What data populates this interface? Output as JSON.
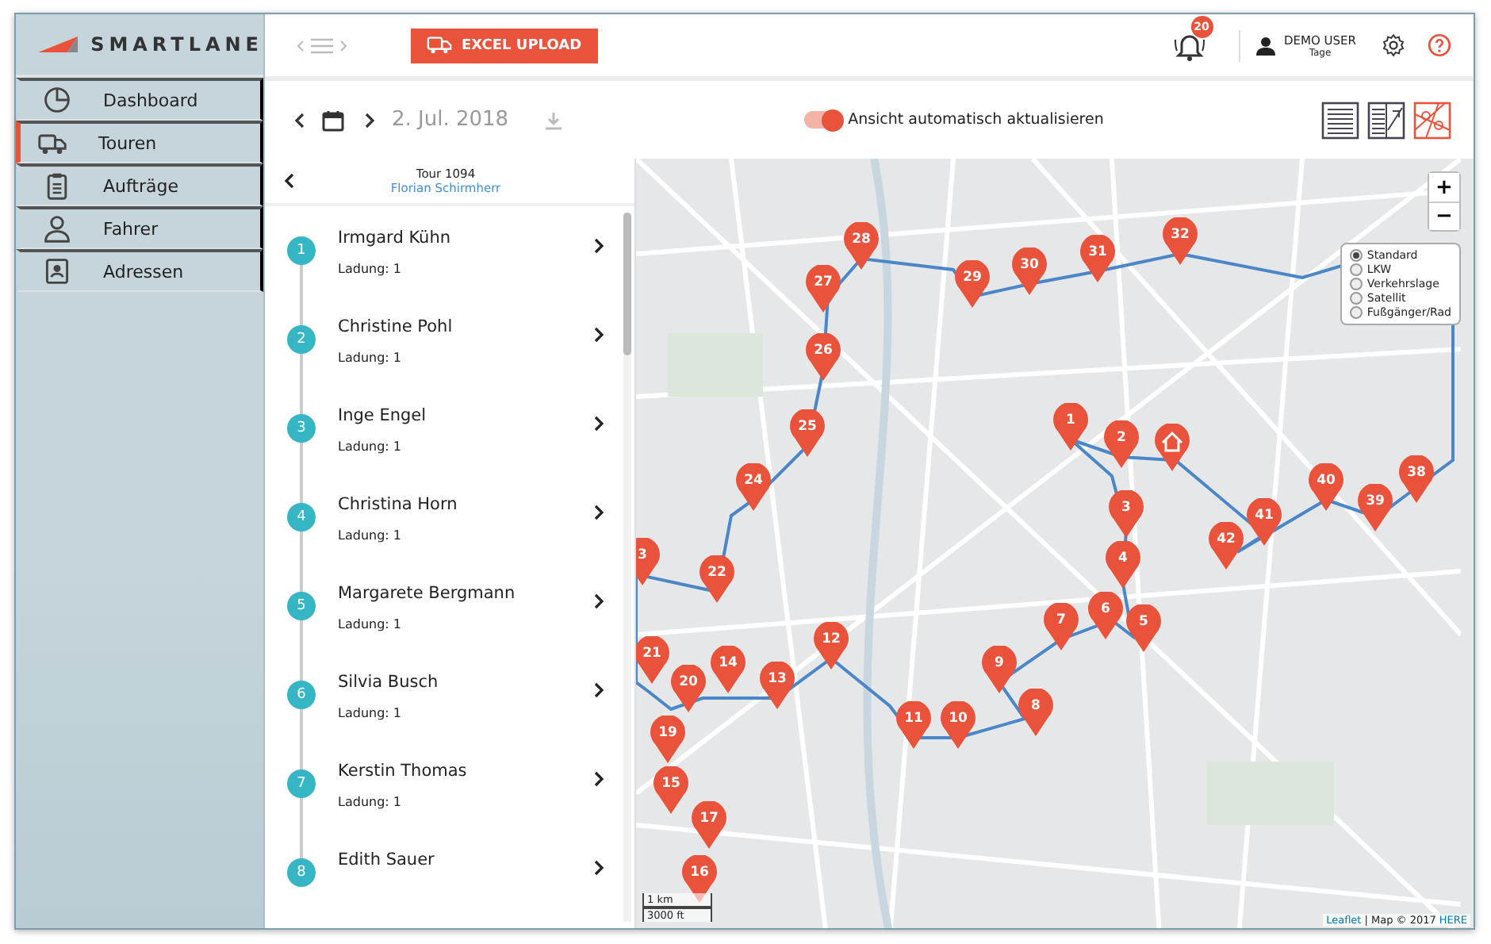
{
  "sidebar": {
    "logo": "SMARTLANE",
    "items": [
      {
        "label": "Dashboard",
        "selected": false
      },
      {
        "label": "Touren",
        "selected": true
      },
      {
        "label": "Aufträge",
        "selected": false
      },
      {
        "label": "Fahrer",
        "selected": false
      },
      {
        "label": "Adressen",
        "selected": false
      }
    ]
  },
  "header": {
    "upload_button": "EXCEL UPLOAD",
    "notifications": "20",
    "user": {
      "name": "DEMO USER",
      "role": "Tage"
    }
  },
  "toolbar": {
    "date": "2. Jul. 2018",
    "auto_refresh": {
      "label": "Ansicht automatisch aktualisieren",
      "on": true
    },
    "views": [
      {
        "selected": false
      },
      {
        "selected": false
      },
      {
        "selected": true
      }
    ]
  },
  "tour": {
    "title": "Tour 1094",
    "driver": "Florian Schirmherr",
    "stops": [
      {
        "number": "1",
        "name": "Irmgard Kühn",
        "load": "Ladung: 1"
      },
      {
        "number": "2",
        "name": "Christine Pohl",
        "load": "Ladung: 1"
      },
      {
        "number": "3",
        "name": "Inge Engel",
        "load": "Ladung: 1"
      },
      {
        "number": "4",
        "name": "Christina Horn",
        "load": "Ladung: 1"
      },
      {
        "number": "5",
        "name": "Margarete Bergmann",
        "load": "Ladung: 1"
      },
      {
        "number": "6",
        "name": "Silvia Busch",
        "load": "Ladung: 1"
      },
      {
        "number": "7",
        "name": "Kerstin Thomas",
        "load": "Ladung: 1"
      },
      {
        "number": "8",
        "name": "Edith Sauer"
      }
    ]
  },
  "map": {
    "markers": [
      {
        "kind": "stop",
        "label": "1"
      },
      {
        "kind": "stop",
        "label": "2"
      },
      {
        "kind": "home"
      },
      {
        "kind": "stop",
        "label": "3"
      },
      {
        "kind": "stop",
        "label": "4"
      },
      {
        "kind": "stop",
        "label": "6"
      },
      {
        "kind": "stop",
        "label": "5"
      },
      {
        "kind": "stop",
        "label": "7"
      },
      {
        "kind": "stop",
        "label": "9"
      },
      {
        "kind": "stop",
        "label": "8"
      },
      {
        "kind": "stop",
        "label": "11"
      },
      {
        "kind": "stop",
        "label": "10"
      },
      {
        "kind": "stop",
        "label": "12"
      },
      {
        "kind": "stop",
        "label": "13"
      },
      {
        "kind": "stop",
        "label": "14"
      },
      {
        "kind": "stop",
        "label": "21"
      },
      {
        "kind": "stop",
        "label": "20"
      },
      {
        "kind": "stop",
        "label": "19"
      },
      {
        "kind": "stop",
        "label": "15"
      },
      {
        "kind": "stop",
        "label": "17"
      },
      {
        "kind": "stop",
        "label": "16"
      },
      {
        "kind": "stop",
        "label": "22"
      },
      {
        "kind": "stop",
        "label": "3"
      },
      {
        "kind": "stop",
        "label": "24"
      },
      {
        "kind": "stop",
        "label": "25"
      },
      {
        "kind": "stop",
        "label": "26"
      },
      {
        "kind": "stop",
        "label": "27"
      },
      {
        "kind": "stop",
        "label": "28"
      },
      {
        "kind": "stop",
        "label": "29"
      },
      {
        "kind": "stop",
        "label": "30"
      },
      {
        "kind": "stop",
        "label": "31"
      },
      {
        "kind": "stop",
        "label": "32"
      },
      {
        "kind": "stop",
        "label": "40"
      },
      {
        "kind": "stop",
        "label": "39"
      },
      {
        "kind": "stop",
        "label": "38"
      },
      {
        "kind": "stop",
        "label": "42"
      },
      {
        "kind": "stop",
        "label": "41"
      }
    ],
    "zoom": [
      "+",
      "−"
    ],
    "layers": [
      {
        "label": "Standard",
        "selected": true
      },
      {
        "label": "LKW",
        "selected": false
      },
      {
        "label": "Verkehrslage",
        "selected": false
      },
      {
        "label": "Satellit",
        "selected": false
      },
      {
        "label": "Fußgänger/Rad",
        "selected": false
      }
    ],
    "scale": [
      "1 km",
      "3000 ft"
    ],
    "attribution": {
      "link": "Leaflet",
      "text": "| Map © 2017",
      "provider": "HERE"
    }
  }
}
